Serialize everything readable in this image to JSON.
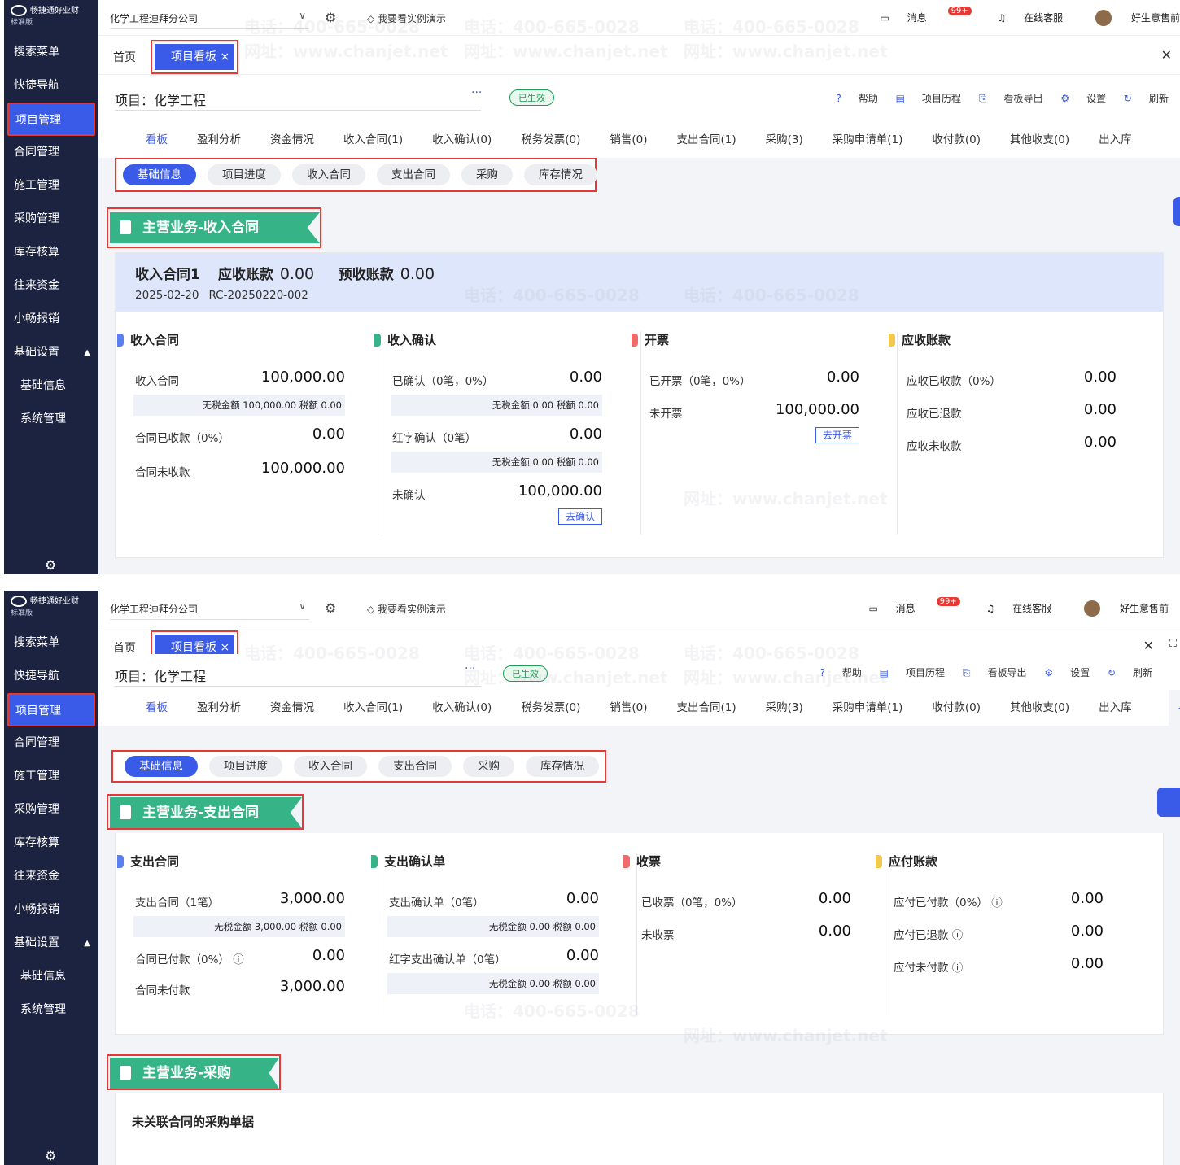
{
  "brand": {
    "name": "畅捷通好业财",
    "edition": "标准版"
  },
  "sidebar": {
    "items": [
      "搜索菜单",
      "快捷导航",
      "项目管理",
      "合同管理",
      "施工管理",
      "采购管理",
      "库存核算",
      "往来资金",
      "小畅报销",
      "基础设置",
      "基础信息",
      "系统管理"
    ]
  },
  "topbar": {
    "company": "化学工程迪拜分公司",
    "demo": "我要看实例演示",
    "messages": "消息",
    "badge": "99+",
    "service": "在线客服",
    "user": "好生意售前"
  },
  "tabs": {
    "home": "首页",
    "active": "项目看板",
    "close": "×"
  },
  "project": {
    "label": "项目：化学工程",
    "more": "···",
    "status": "已生效"
  },
  "tools": [
    "帮助",
    "项目历程",
    "看板导出",
    "设置",
    "刷新"
  ],
  "subtabs": [
    "看板",
    "盈利分析",
    "资金情况",
    "收入合同(1)",
    "收入确认(0)",
    "税务发票(0)",
    "销售(0)",
    "支出合同(1)",
    "采购(3)",
    "采购申请单(1)",
    "收付款(0)",
    "其他收支(0)",
    "出入库"
  ],
  "pills": [
    "基础信息",
    "项目进度",
    "收入合同",
    "支出合同",
    "采购",
    "库存情况"
  ],
  "income": {
    "section": "主营业务-收入合同",
    "head": {
      "name": "收入合同1",
      "ar_label": "应收账款",
      "ar": "0.00",
      "pre_label": "预收账款",
      "pre": "0.00",
      "date": "2025-02-20",
      "code": "RC-20250220-002"
    },
    "c1": {
      "title": "收入合同",
      "r1": "收入合同",
      "v1": "100,000.00",
      "tax": "无税金额 100,000.00 税额 0.00",
      "r2": "合同已收款（0%）",
      "v2": "0.00",
      "r3": "合同未收款",
      "v3": "100,000.00"
    },
    "c2": {
      "title": "收入确认",
      "r1": "已确认（0笔，0%）",
      "v1": "0.00",
      "tax1": "无税金额 0.00 税额 0.00",
      "r2": "红字确认（0笔）",
      "v2": "0.00",
      "tax2": "无税金额 0.00 税额 0.00",
      "r3": "未确认",
      "v3": "100,000.00",
      "btn": "去确认"
    },
    "c3": {
      "title": "开票",
      "r1": "已开票（0笔，0%）",
      "v1": "0.00",
      "r2": "未开票",
      "v2": "100,000.00",
      "btn": "去开票"
    },
    "c4": {
      "title": "应收账款",
      "r1": "应收已收款（0%）",
      "v1": "0.00",
      "r2": "应收已退款",
      "v2": "0.00",
      "r3": "应收未收款",
      "v3": "0.00"
    }
  },
  "expense": {
    "section": "主营业务-支出合同",
    "c1": {
      "title": "支出合同",
      "r1": "支出合同（1笔）",
      "v1": "3,000.00",
      "tax": "无税金额 3,000.00 税额 0.00",
      "r2": "合同已付款（0%） ⓘ",
      "v2": "0.00",
      "r3": "合同未付款",
      "v3": "3,000.00"
    },
    "c2": {
      "title": "支出确认单",
      "r1": "支出确认单（0笔）",
      "v1": "0.00",
      "tax1": "无税金额 0.00 税额 0.00",
      "r2": "红字支出确认单（0笔）",
      "v2": "0.00",
      "tax2": "无税金额 0.00 税额 0.00"
    },
    "c3": {
      "title": "收票",
      "r1": "已收票（0笔，0%）",
      "v1": "0.00",
      "r2": "未收票",
      "v2": "0.00"
    },
    "c4": {
      "title": "应付账款",
      "r1": "应付已付款（0%） ⓘ",
      "v1": "0.00",
      "r2": "应付已退款 ⓘ",
      "v2": "0.00",
      "r3": "应付未付款 ⓘ",
      "v3": "0.00"
    }
  },
  "purchase": {
    "section": "主营业务-采购",
    "nolink": "未关联合同的采购单据"
  },
  "watermark": {
    "phone": "电话：400-665-0028",
    "site": "网址：www.chanjet.net"
  },
  "colors": {
    "primary": "#3a5ae8",
    "sidebar": "#1b2341",
    "green": "#36b487",
    "highlight": "#e53935"
  }
}
